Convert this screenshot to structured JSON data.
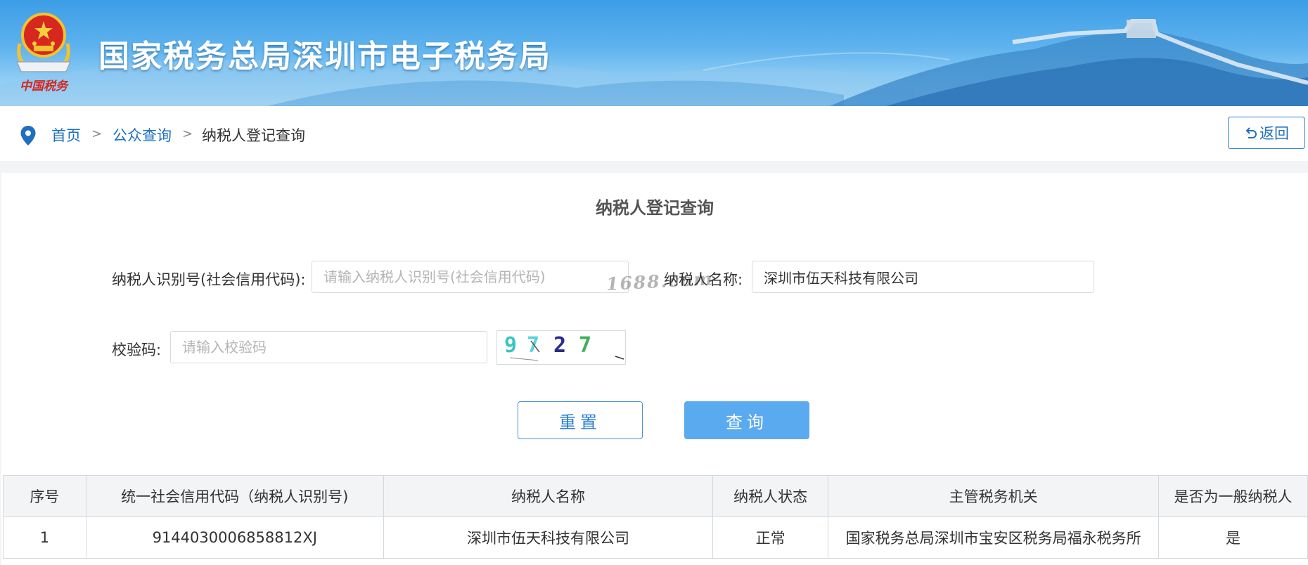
{
  "header": {
    "site_title": "国家税务总局深圳市电子税务局",
    "emblem_icon": "national-tax-emblem-icon",
    "emblem_caption": "中国税务"
  },
  "breadcrumb": {
    "icon": "location-pin-icon",
    "items": [
      "首页",
      "公众查询",
      "纳税人登记查询"
    ],
    "separator": ">",
    "back_label": "返回"
  },
  "form": {
    "title": "纳税人登记查询",
    "taxpayer_id_label": "纳税人识别号(社会信用代码):",
    "taxpayer_id_value": "",
    "taxpayer_id_placeholder": "请输入纳税人识别号(社会信用代码)",
    "taxpayer_name_label": "纳税人名称:",
    "taxpayer_name_value": "深圳市伍天科技有限公司",
    "captcha_label": "校验码:",
    "captcha_value": "",
    "captcha_placeholder": "请输入校验码",
    "captcha_image_text": "9727",
    "watermark": "1688.com",
    "reset_label": "重置",
    "query_label": "查询"
  },
  "table": {
    "headers": [
      "序号",
      "统一社会信用代码（纳税人识别号)",
      "纳税人名称",
      "纳税人状态",
      "主管税务机关",
      "是否为一般纳税人"
    ],
    "rows": [
      [
        "1",
        "9144030006858812XJ",
        "深圳市伍天科技有限公司",
        "正常",
        "国家税务总局深圳市宝安区税务局福永税务所",
        "是"
      ]
    ]
  },
  "colors": {
    "link": "#1f6fc0",
    "primary_button": "#5aaaf0",
    "banner": "#3c9de6"
  }
}
